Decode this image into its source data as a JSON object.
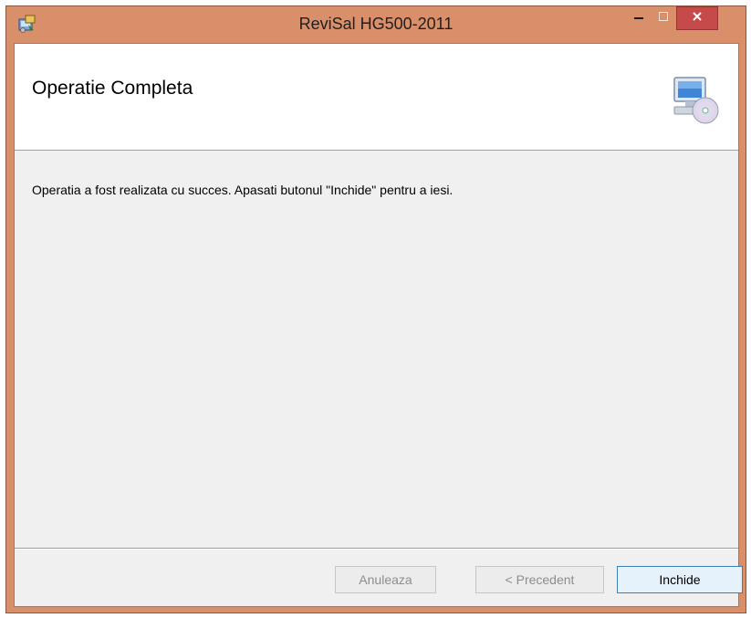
{
  "window": {
    "title": "ReviSal HG500-2011",
    "icon": "installer-icon",
    "controls": {
      "minimize": "minimize-icon",
      "maximize": "maximize-icon",
      "close": "close-icon"
    },
    "accent_color": "#d9906a",
    "close_color": "#c74a4a"
  },
  "header": {
    "title": "Operatie Completa",
    "icon": "computer-cd-icon"
  },
  "body": {
    "message": "Operatia a fost realizata cu succes. Apasati butonul \"Inchide\" pentru a iesi."
  },
  "buttons": {
    "cancel": "Anuleaza",
    "previous": "< Precedent",
    "close": "Inchide"
  }
}
